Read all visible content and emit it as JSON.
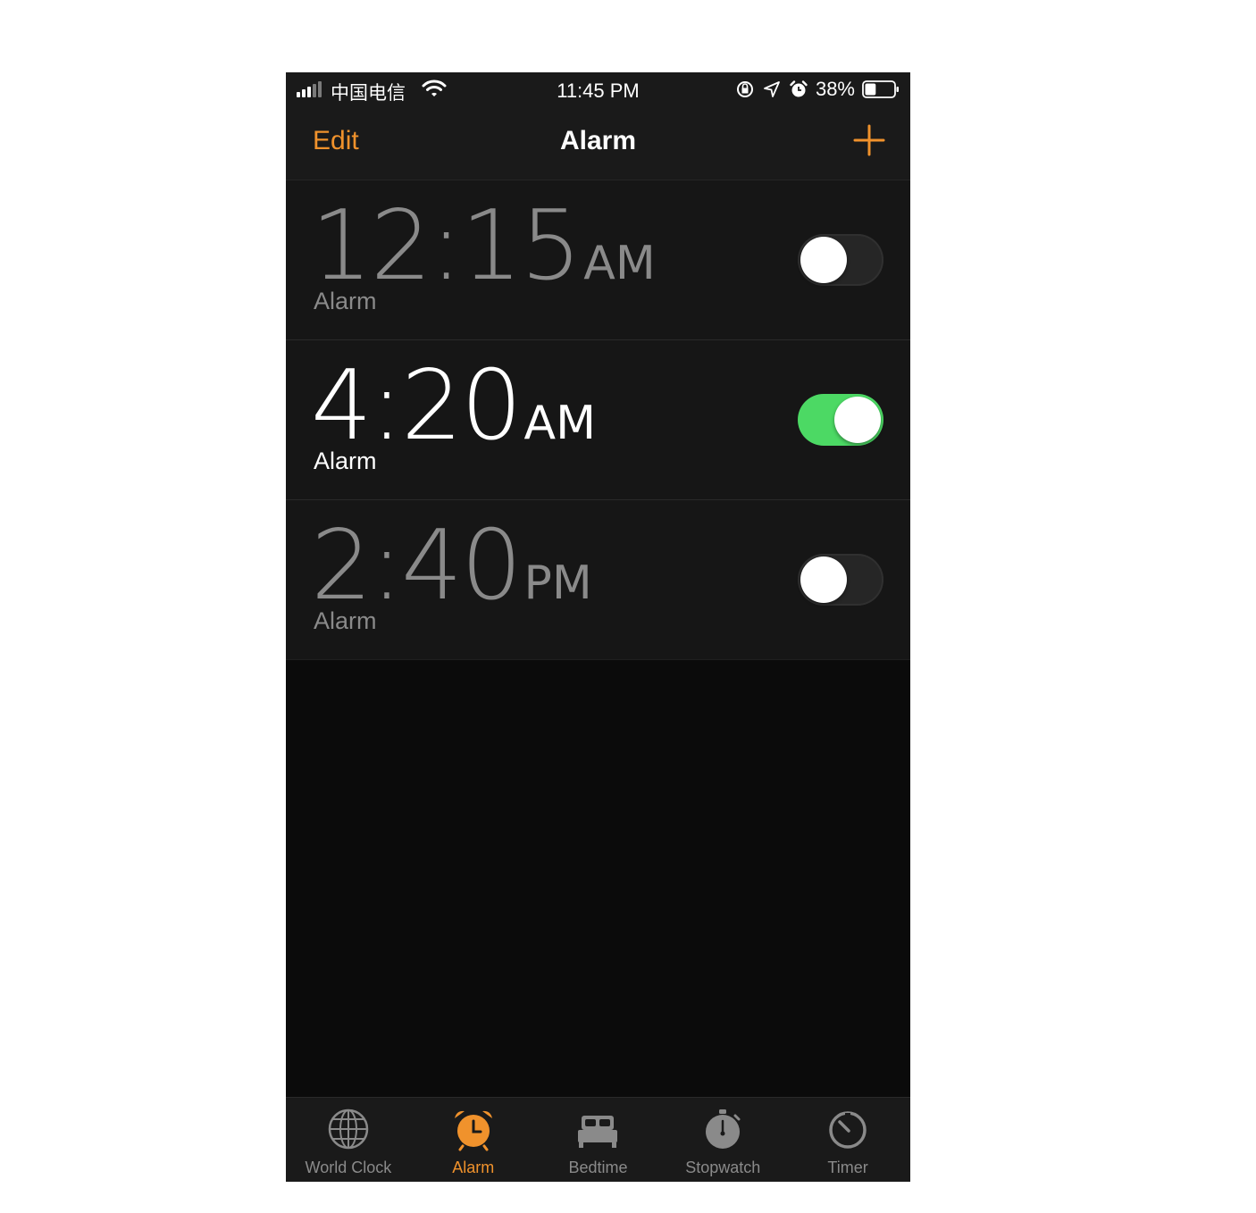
{
  "status_bar": {
    "carrier": "中国电信",
    "time": "11:45 PM",
    "battery_percent": "38%",
    "battery_level": 0.38,
    "icons": [
      "signal-icon",
      "wifi-icon",
      "rotation-lock-icon",
      "location-icon",
      "alarm-clock-icon",
      "battery-icon"
    ]
  },
  "navbar": {
    "edit_label": "Edit",
    "title": "Alarm",
    "add_icon": "plus-icon"
  },
  "alarms": [
    {
      "time": "12:15",
      "period": "AM",
      "label": "Alarm",
      "enabled": false
    },
    {
      "time": "4:20",
      "period": "AM",
      "label": "Alarm",
      "enabled": true
    },
    {
      "time": "2:40",
      "period": "PM",
      "label": "Alarm",
      "enabled": false
    }
  ],
  "tabs": [
    {
      "label": "World Clock",
      "icon": "globe-icon",
      "active": false
    },
    {
      "label": "Alarm",
      "icon": "alarm-clock-icon",
      "active": true
    },
    {
      "label": "Bedtime",
      "icon": "bed-icon",
      "active": false
    },
    {
      "label": "Stopwatch",
      "icon": "stopwatch-icon",
      "active": false
    },
    {
      "label": "Timer",
      "icon": "timer-icon",
      "active": false
    }
  ],
  "colors": {
    "accent": "#f0922c",
    "toggle_on": "#4cd964",
    "background": "#0b0b0b",
    "row": "#161616"
  }
}
